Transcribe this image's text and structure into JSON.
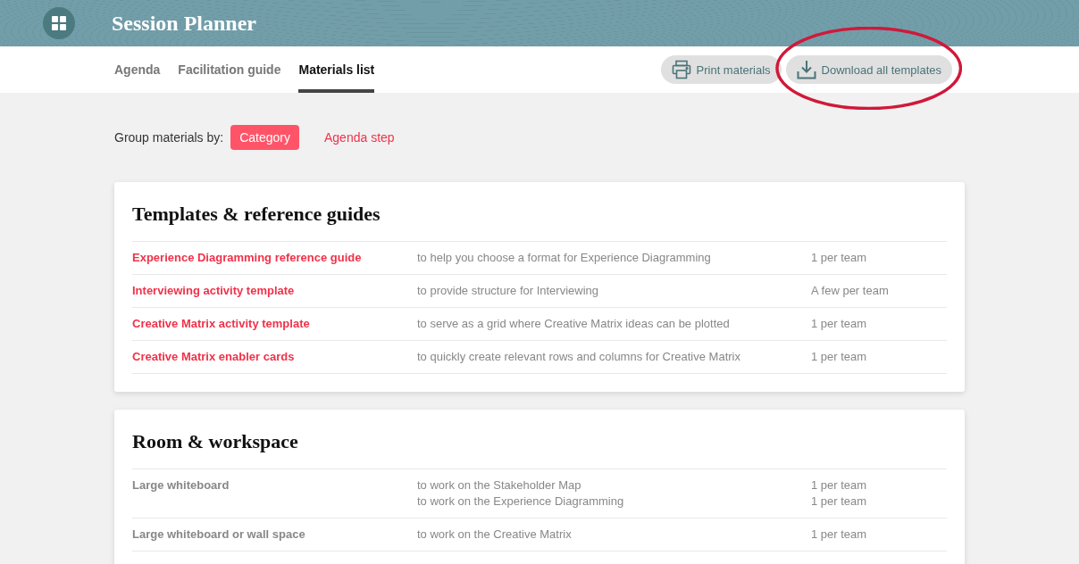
{
  "header": {
    "title": "Session Planner"
  },
  "tabs": [
    {
      "label": "Agenda",
      "selected": false
    },
    {
      "label": "Facilitation guide",
      "selected": false
    },
    {
      "label": "Materials list",
      "selected": true
    }
  ],
  "actions": [
    {
      "label": "Print materials",
      "kind": "print",
      "highlighted": false
    },
    {
      "label": "Download all templates",
      "kind": "download",
      "highlighted": true
    }
  ],
  "grouping": {
    "label": "Group materials by:",
    "options": [
      {
        "label": "Category",
        "selected": true
      },
      {
        "label": "Agenda step",
        "selected": false
      }
    ]
  },
  "sections": [
    {
      "title": "Templates & reference guides",
      "items": [
        {
          "name": "Experience Diagramming reference guide",
          "kind": "link",
          "uses": [
            {
              "purpose": "to help you choose a format for Experience Diagramming",
              "quantity": "1 per team"
            }
          ]
        },
        {
          "name": "Interviewing activity template",
          "kind": "link",
          "uses": [
            {
              "purpose": "to provide structure for Interviewing",
              "quantity": "A few per team"
            }
          ]
        },
        {
          "name": "Creative Matrix activity template",
          "kind": "link",
          "uses": [
            {
              "purpose": "to serve as a grid where Creative Matrix ideas can be plotted",
              "quantity": "1 per team"
            }
          ]
        },
        {
          "name": "Creative Matrix enabler cards",
          "kind": "link",
          "uses": [
            {
              "purpose": "to quickly create relevant rows and columns for Creative Matrix",
              "quantity": "1 per team"
            }
          ]
        }
      ]
    },
    {
      "title": "Room & workspace",
      "items": [
        {
          "name": "Large whiteboard",
          "kind": "plain",
          "uses": [
            {
              "purpose": "to work on the Stakeholder Map",
              "quantity": "1 per team"
            },
            {
              "purpose": "to work on the Experience Diagramming",
              "quantity": "1 per team"
            }
          ]
        },
        {
          "name": "Large whiteboard or wall space",
          "kind": "plain",
          "uses": [
            {
              "purpose": "to work on the Creative Matrix",
              "quantity": "1 per team"
            }
          ]
        }
      ]
    }
  ]
}
